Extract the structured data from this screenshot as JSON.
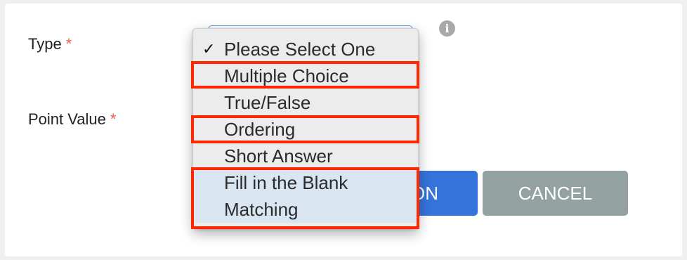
{
  "form": {
    "type_label": "Type",
    "type_required_marker": "*",
    "point_value_label": "Point Value",
    "point_value_required_marker": "*",
    "info_icon_glyph": "i",
    "info_icon": "info-circle-icon"
  },
  "dropdown": {
    "options": [
      {
        "label": "Please Select One",
        "selected": true
      },
      {
        "label": "Multiple Choice",
        "selected": false
      },
      {
        "label": "True/False",
        "selected": false
      },
      {
        "label": "Ordering",
        "selected": false
      },
      {
        "label": "Short Answer",
        "selected": false
      },
      {
        "label": "Fill in the Blank",
        "selected": false
      },
      {
        "label": "Matching",
        "selected": false
      }
    ],
    "check_glyph": "✓"
  },
  "buttons": {
    "primary_partial_label": "ON",
    "cancel_label": "CANCEL"
  },
  "colors": {
    "accent_primary": "#3473d9",
    "cancel_bg": "#93a2a0",
    "required_marker": "#e8604c",
    "highlight_outline": "#ff2800"
  }
}
